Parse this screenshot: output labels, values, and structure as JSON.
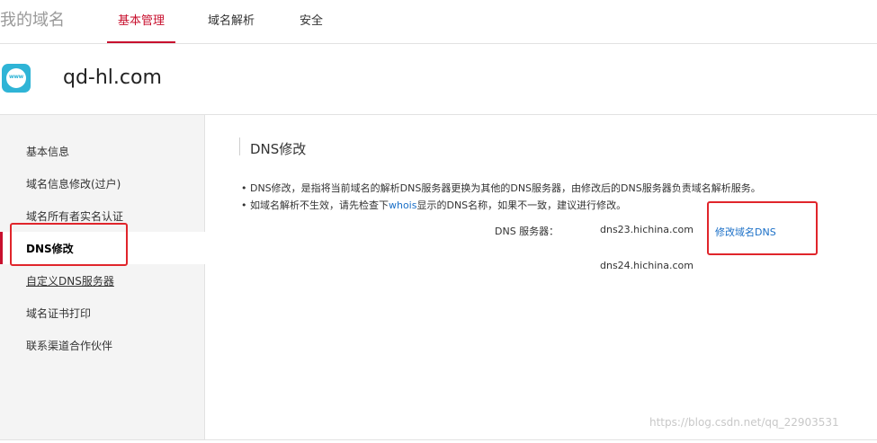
{
  "header": {
    "brand": "我的域名",
    "tabs": [
      "基本管理",
      "域名解析",
      "安全"
    ]
  },
  "domain": {
    "icon_text": "www",
    "name": "qd-hl.com"
  },
  "sidebar": {
    "items": [
      {
        "label": "基本信息"
      },
      {
        "label": "域名信息修改(过户)"
      },
      {
        "label": "域名所有者实名认证"
      },
      {
        "label": "DNS修改"
      },
      {
        "label": "自定义DNS服务器"
      },
      {
        "label": "域名证书打印"
      },
      {
        "label": "联系渠道合作伙伴"
      }
    ]
  },
  "main": {
    "title": "DNS修改",
    "note1": "• DNS修改，是指将当前域名的解析DNS服务器更换为其他的DNS服务器，由修改后的DNS服务器负责域名解析服务。",
    "note2_prefix": "• 如域名解析不生效，请先检查下",
    "note2_link": "whois",
    "note2_suffix": "显示的DNS名称，如果不一致，建议进行修改。",
    "dns_label": "DNS 服务器：",
    "dns_servers": [
      "dns23.hichina.com",
      "dns24.hichina.com"
    ],
    "modify_link": "修改域名DNS"
  },
  "watermark": "https://blog.csdn.net/qq_22903531",
  "colors": {
    "accent": "#c8102e",
    "link": "#1a6fc7",
    "annotation": "#e0252b",
    "icon": "#2fb4d6"
  }
}
